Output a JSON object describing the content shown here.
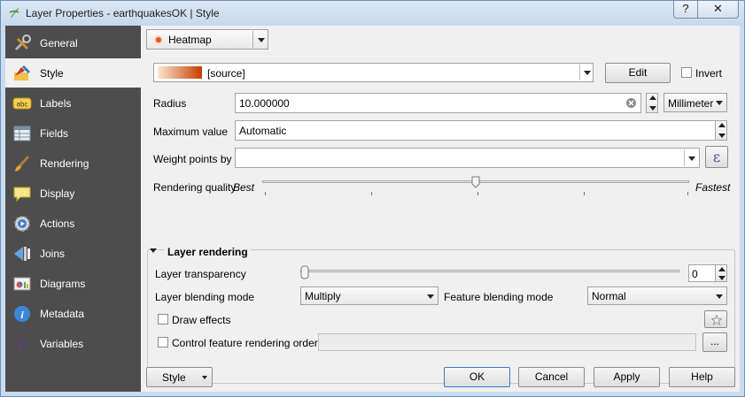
{
  "window": {
    "title": "Layer Properties - earthquakesOK | Style",
    "help_label": "?",
    "close_label": "✕"
  },
  "sidebar": {
    "items": [
      {
        "label": "General",
        "icon": "tools-icon"
      },
      {
        "label": "Style",
        "icon": "style-icon"
      },
      {
        "label": "Labels",
        "icon": "labels-abc-icon"
      },
      {
        "label": "Fields",
        "icon": "fields-table-icon"
      },
      {
        "label": "Rendering",
        "icon": "paintbrush-icon"
      },
      {
        "label": "Display",
        "icon": "speech-bubble-icon"
      },
      {
        "label": "Actions",
        "icon": "gear-play-icon"
      },
      {
        "label": "Joins",
        "icon": "joins-icon"
      },
      {
        "label": "Diagrams",
        "icon": "diagram-icon"
      },
      {
        "label": "Metadata",
        "icon": "info-icon"
      },
      {
        "label": "Variables",
        "icon": "epsilon-icon"
      }
    ],
    "active_index": 1
  },
  "renderer": {
    "type_label": "Heatmap",
    "ramp_label": "[source]",
    "edit_label": "Edit",
    "invert_label": "Invert",
    "invert_checked": false
  },
  "radius": {
    "label": "Radius",
    "value": "10.000000",
    "unit": "Millimeter"
  },
  "max_value": {
    "label": "Maximum value",
    "value": "Automatic"
  },
  "weight": {
    "label": "Weight points by",
    "value": ""
  },
  "quality": {
    "label": "Rendering quality",
    "best_label": "Best",
    "fastest_label": "Fastest",
    "level_fraction": 0.5
  },
  "layer_rendering": {
    "title": "Layer rendering",
    "transparency_label": "Layer transparency",
    "transparency_value": "0",
    "transparency_fraction": 0,
    "blend_label": "Layer blending mode",
    "blend_value": "Multiply",
    "feature_blend_label": "Feature blending mode",
    "feature_blend_value": "Normal",
    "draw_effects_label": "Draw effects",
    "draw_effects_checked": false,
    "order_label": "Control feature rendering order",
    "order_checked": false,
    "order_value": "",
    "ellipsis_label": "..."
  },
  "footer": {
    "style_label": "Style",
    "ok_label": "OK",
    "cancel_label": "Cancel",
    "apply_label": "Apply",
    "help_label": "Help"
  },
  "colors": {
    "sidebar_bg": "#4d4d4d",
    "ramp_start": "#fde7d0",
    "ramp_end": "#c63c00",
    "heatmap_dot": "#e8522a"
  }
}
